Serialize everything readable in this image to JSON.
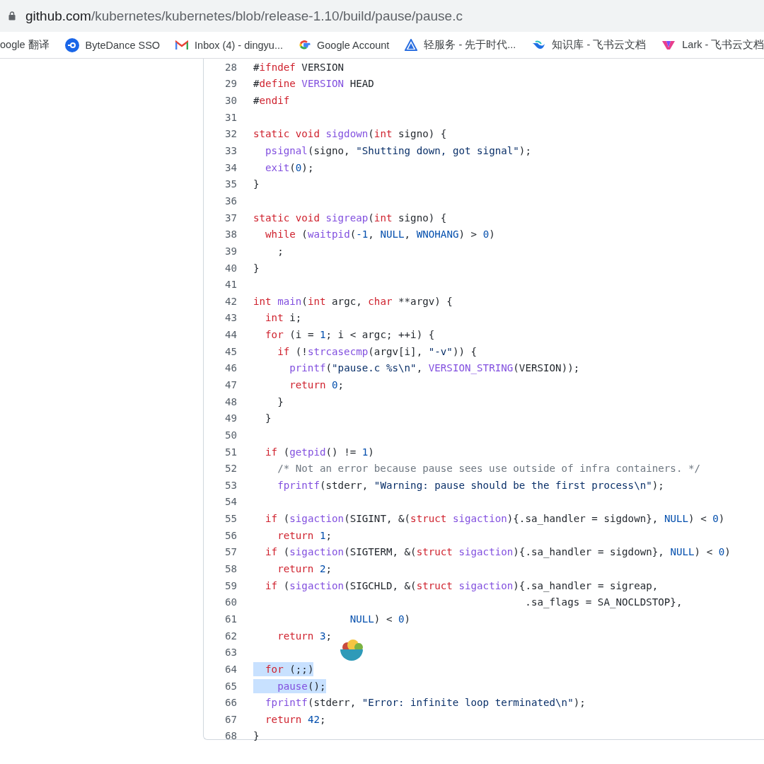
{
  "address_bar": {
    "host": "github.com",
    "path": "/kubernetes/kubernetes/blob/release-1.10/build/pause/pause.c"
  },
  "bookmarks": [
    {
      "kind": "none",
      "label": "oogle 翻译"
    },
    {
      "kind": "sso",
      "label": "ByteDance SSO"
    },
    {
      "kind": "mail",
      "label": "Inbox (4) - dingyu..."
    },
    {
      "kind": "google",
      "label": "Google Account"
    },
    {
      "kind": "triangle",
      "label": "轻服务 - 先于时代..."
    },
    {
      "kind": "swirl",
      "label": "知识库 - 飞书云文档"
    },
    {
      "kind": "lark",
      "label": "Lark - 飞书云文档"
    }
  ],
  "code": {
    "lines": [
      {
        "number": "28",
        "selected": false,
        "tokens": [
          {
            "kind": "plain",
            "text": "#"
          },
          {
            "kind": "keyword",
            "text": "ifndef"
          },
          {
            "kind": "plain",
            "text": " VERSION"
          }
        ]
      },
      {
        "number": "29",
        "selected": false,
        "tokens": [
          {
            "kind": "plain",
            "text": "#"
          },
          {
            "kind": "keyword",
            "text": "define "
          },
          {
            "kind": "function",
            "text": "VERSION"
          },
          {
            "kind": "plain",
            "text": " HEAD"
          }
        ]
      },
      {
        "number": "30",
        "selected": false,
        "tokens": [
          {
            "kind": "plain",
            "text": "#"
          },
          {
            "kind": "keyword",
            "text": "endif"
          }
        ]
      },
      {
        "number": "31",
        "selected": false
      },
      {
        "number": "32",
        "selected": false,
        "tokens": [
          {
            "kind": "keyword",
            "text": "static void "
          },
          {
            "kind": "function",
            "text": "sigdown"
          },
          {
            "kind": "plain",
            "text": "("
          },
          {
            "kind": "keyword",
            "text": "int"
          },
          {
            "kind": "plain",
            "text": " signo) {"
          }
        ]
      },
      {
        "number": "33",
        "selected": false,
        "tokens": [
          {
            "kind": "function",
            "text": "  psignal"
          },
          {
            "kind": "plain",
            "text": "(signo, "
          },
          {
            "kind": "string",
            "text": "\"Shutting down, got signal\""
          },
          {
            "kind": "plain",
            "text": ");"
          }
        ]
      },
      {
        "number": "34",
        "selected": false,
        "tokens": [
          {
            "kind": "function",
            "text": "  exit"
          },
          {
            "kind": "plain",
            "text": "("
          },
          {
            "kind": "constant",
            "text": "0"
          },
          {
            "kind": "plain",
            "text": ");"
          }
        ]
      },
      {
        "number": "35",
        "selected": false,
        "tokens": [
          {
            "kind": "plain",
            "text": "}"
          }
        ]
      },
      {
        "number": "36",
        "selected": false
      },
      {
        "number": "37",
        "selected": false,
        "tokens": [
          {
            "kind": "keyword",
            "text": "static void "
          },
          {
            "kind": "function",
            "text": "sigreap"
          },
          {
            "kind": "plain",
            "text": "("
          },
          {
            "kind": "keyword",
            "text": "int"
          },
          {
            "kind": "plain",
            "text": " signo) {"
          }
        ]
      },
      {
        "number": "38",
        "selected": false,
        "tokens": [
          {
            "kind": "keyword",
            "text": "  while"
          },
          {
            "kind": "plain",
            "text": " ("
          },
          {
            "kind": "function",
            "text": "waitpid"
          },
          {
            "kind": "plain",
            "text": "("
          },
          {
            "kind": "constant",
            "text": "-1"
          },
          {
            "kind": "plain",
            "text": ", "
          },
          {
            "kind": "constant",
            "text": "NULL"
          },
          {
            "kind": "plain",
            "text": ", "
          },
          {
            "kind": "constant",
            "text": "WNOHANG"
          },
          {
            "kind": "plain",
            "text": ") > "
          },
          {
            "kind": "constant",
            "text": "0"
          },
          {
            "kind": "plain",
            "text": ")"
          }
        ]
      },
      {
        "number": "39",
        "selected": false,
        "tokens": [
          {
            "kind": "plain",
            "text": "    ;"
          }
        ]
      },
      {
        "number": "40",
        "selected": false,
        "tokens": [
          {
            "kind": "plain",
            "text": "}"
          }
        ]
      },
      {
        "number": "41",
        "selected": false
      },
      {
        "number": "42",
        "selected": false,
        "tokens": [
          {
            "kind": "keyword",
            "text": "int "
          },
          {
            "kind": "function",
            "text": "main"
          },
          {
            "kind": "plain",
            "text": "("
          },
          {
            "kind": "keyword",
            "text": "int"
          },
          {
            "kind": "plain",
            "text": " argc, "
          },
          {
            "kind": "keyword",
            "text": "char"
          },
          {
            "kind": "plain",
            "text": " **argv) {"
          }
        ]
      },
      {
        "number": "43",
        "selected": false,
        "tokens": [
          {
            "kind": "keyword",
            "text": "  int"
          },
          {
            "kind": "plain",
            "text": " i;"
          }
        ]
      },
      {
        "number": "44",
        "selected": false,
        "tokens": [
          {
            "kind": "keyword",
            "text": "  for"
          },
          {
            "kind": "plain",
            "text": " (i = "
          },
          {
            "kind": "constant",
            "text": "1"
          },
          {
            "kind": "plain",
            "text": "; i < argc; ++i) {"
          }
        ]
      },
      {
        "number": "45",
        "selected": false,
        "tokens": [
          {
            "kind": "keyword",
            "text": "    if"
          },
          {
            "kind": "plain",
            "text": " (!"
          },
          {
            "kind": "function",
            "text": "strcasecmp"
          },
          {
            "kind": "plain",
            "text": "(argv[i], "
          },
          {
            "kind": "string",
            "text": "\"-v\""
          },
          {
            "kind": "plain",
            "text": ")) {"
          }
        ]
      },
      {
        "number": "46",
        "selected": false,
        "tokens": [
          {
            "kind": "function",
            "text": "      printf"
          },
          {
            "kind": "plain",
            "text": "("
          },
          {
            "kind": "string",
            "text": "\"pause.c %s\\n\""
          },
          {
            "kind": "plain",
            "text": ", "
          },
          {
            "kind": "function",
            "text": "VERSION_STRING"
          },
          {
            "kind": "plain",
            "text": "(VERSION));"
          }
        ]
      },
      {
        "number": "47",
        "selected": false,
        "tokens": [
          {
            "kind": "keyword",
            "text": "      return "
          },
          {
            "kind": "constant",
            "text": "0"
          },
          {
            "kind": "plain",
            "text": ";"
          }
        ]
      },
      {
        "number": "48",
        "selected": false,
        "tokens": [
          {
            "kind": "plain",
            "text": "    }"
          }
        ]
      },
      {
        "number": "49",
        "selected": false,
        "tokens": [
          {
            "kind": "plain",
            "text": "  }"
          }
        ]
      },
      {
        "number": "50",
        "selected": false
      },
      {
        "number": "51",
        "selected": false,
        "tokens": [
          {
            "kind": "keyword",
            "text": "  if"
          },
          {
            "kind": "plain",
            "text": " ("
          },
          {
            "kind": "function",
            "text": "getpid"
          },
          {
            "kind": "plain",
            "text": "() != "
          },
          {
            "kind": "constant",
            "text": "1"
          },
          {
            "kind": "plain",
            "text": ")"
          }
        ]
      },
      {
        "number": "52",
        "selected": false,
        "tokens": [
          {
            "kind": "comment",
            "text": "    /* Not an error because pause sees use outside of infra containers. */"
          }
        ]
      },
      {
        "number": "53",
        "selected": false,
        "tokens": [
          {
            "kind": "function",
            "text": "    fprintf"
          },
          {
            "kind": "plain",
            "text": "(stderr, "
          },
          {
            "kind": "string",
            "text": "\"Warning: pause should be the first process\\n\""
          },
          {
            "kind": "plain",
            "text": ");"
          }
        ]
      },
      {
        "number": "54",
        "selected": false
      },
      {
        "number": "55",
        "selected": false,
        "tokens": [
          {
            "kind": "keyword",
            "text": "  if"
          },
          {
            "kind": "plain",
            "text": " ("
          },
          {
            "kind": "function",
            "text": "sigaction"
          },
          {
            "kind": "plain",
            "text": "(SIGINT, &("
          },
          {
            "kind": "keyword",
            "text": "struct "
          },
          {
            "kind": "function",
            "text": "sigaction"
          },
          {
            "kind": "plain",
            "text": "){.sa_handler = sigdown}, "
          },
          {
            "kind": "constant",
            "text": "NULL"
          },
          {
            "kind": "plain",
            "text": ") < "
          },
          {
            "kind": "constant",
            "text": "0"
          },
          {
            "kind": "plain",
            "text": ")"
          }
        ]
      },
      {
        "number": "56",
        "selected": false,
        "tokens": [
          {
            "kind": "keyword",
            "text": "    return "
          },
          {
            "kind": "constant",
            "text": "1"
          },
          {
            "kind": "plain",
            "text": ";"
          }
        ]
      },
      {
        "number": "57",
        "selected": false,
        "tokens": [
          {
            "kind": "keyword",
            "text": "  if"
          },
          {
            "kind": "plain",
            "text": " ("
          },
          {
            "kind": "function",
            "text": "sigaction"
          },
          {
            "kind": "plain",
            "text": "(SIGTERM, &("
          },
          {
            "kind": "keyword",
            "text": "struct "
          },
          {
            "kind": "function",
            "text": "sigaction"
          },
          {
            "kind": "plain",
            "text": "){.sa_handler = sigdown}, "
          },
          {
            "kind": "constant",
            "text": "NULL"
          },
          {
            "kind": "plain",
            "text": ") < "
          },
          {
            "kind": "constant",
            "text": "0"
          },
          {
            "kind": "plain",
            "text": ")"
          }
        ]
      },
      {
        "number": "58",
        "selected": false,
        "tokens": [
          {
            "kind": "keyword",
            "text": "    return "
          },
          {
            "kind": "constant",
            "text": "2"
          },
          {
            "kind": "plain",
            "text": ";"
          }
        ]
      },
      {
        "number": "59",
        "selected": false,
        "tokens": [
          {
            "kind": "keyword",
            "text": "  if"
          },
          {
            "kind": "plain",
            "text": " ("
          },
          {
            "kind": "function",
            "text": "sigaction"
          },
          {
            "kind": "plain",
            "text": "(SIGCHLD, &("
          },
          {
            "kind": "keyword",
            "text": "struct "
          },
          {
            "kind": "function",
            "text": "sigaction"
          },
          {
            "kind": "plain",
            "text": "){.sa_handler = sigreap,"
          }
        ]
      },
      {
        "number": "60",
        "selected": false,
        "tokens": [
          {
            "kind": "plain",
            "text": "                                             .sa_flags = SA_NOCLDSTOP},"
          }
        ]
      },
      {
        "number": "61",
        "selected": false,
        "tokens": [
          {
            "kind": "constant",
            "text": "                NULL"
          },
          {
            "kind": "plain",
            "text": ") < "
          },
          {
            "kind": "constant",
            "text": "0"
          },
          {
            "kind": "plain",
            "text": ")"
          }
        ]
      },
      {
        "number": "62",
        "selected": false,
        "tokens": [
          {
            "kind": "keyword",
            "text": "    return "
          },
          {
            "kind": "constant",
            "text": "3"
          },
          {
            "kind": "plain",
            "text": ";"
          }
        ]
      },
      {
        "number": "63",
        "selected": false
      },
      {
        "number": "64",
        "selected": true,
        "tokens": [
          {
            "kind": "keyword",
            "text": "  for"
          },
          {
            "kind": "plain",
            "text": " (;;)"
          }
        ]
      },
      {
        "number": "65",
        "selected": true,
        "tokens": [
          {
            "kind": "function",
            "text": "    pause"
          },
          {
            "kind": "plain",
            "text": "();"
          }
        ]
      },
      {
        "number": "66",
        "selected": false,
        "tokens": [
          {
            "kind": "function",
            "text": "  fprintf"
          },
          {
            "kind": "plain",
            "text": "(stderr, "
          },
          {
            "kind": "string",
            "text": "\"Error: infinite loop terminated\\n\""
          },
          {
            "kind": "plain",
            "text": ");"
          }
        ]
      },
      {
        "number": "67",
        "selected": false,
        "tokens": [
          {
            "kind": "keyword",
            "text": "  return "
          },
          {
            "kind": "constant",
            "text": "42"
          },
          {
            "kind": "plain",
            "text": ";"
          }
        ]
      },
      {
        "number": "68",
        "selected": false,
        "tokens": [
          {
            "kind": "plain",
            "text": "}"
          }
        ]
      }
    ]
  }
}
